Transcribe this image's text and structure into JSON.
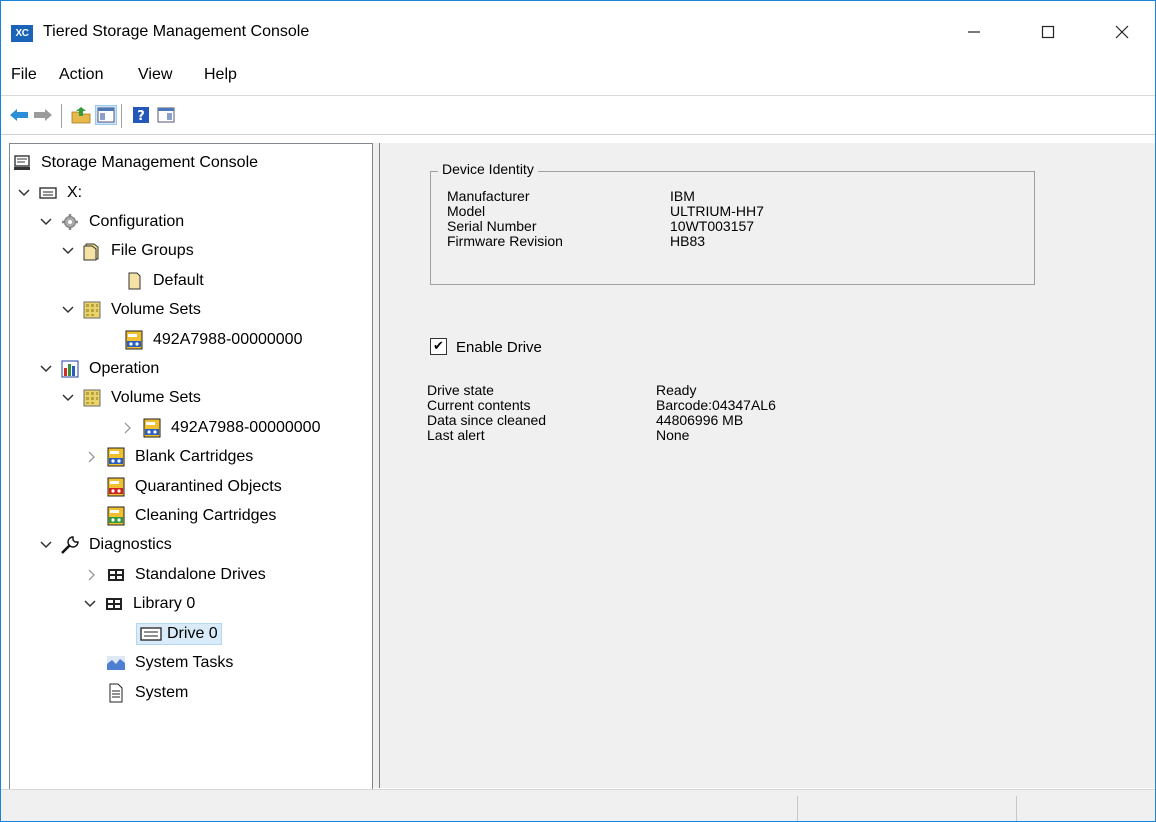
{
  "app": {
    "icon_text": "XC",
    "title": "Tiered Storage Management Console"
  },
  "window_controls": {
    "minimize": "—",
    "maximize": "☐",
    "close": "✕"
  },
  "menu": [
    "File",
    "Action",
    "View",
    "Help"
  ],
  "toolbar": {
    "buttons": [
      {
        "icon": "back-arrow-icon"
      },
      {
        "icon": "forward-arrow-icon"
      },
      {
        "icon": "up-folder-icon"
      },
      {
        "icon": "show-hide-tree-icon",
        "pressed": true
      },
      {
        "icon": "help-icon"
      },
      {
        "icon": "action-pane-icon"
      }
    ]
  },
  "tree": {
    "root": "Storage Management Console",
    "server": "X:",
    "configuration": "Configuration",
    "file_groups": "File Groups",
    "default": "Default",
    "volume_sets_config": "Volume Sets",
    "volume_config_item": "492A7988-00000000",
    "operation": "Operation",
    "volume_sets_op": "Volume Sets",
    "volume_op_item": "492A7988-00000000",
    "blank_cartridges": "Blank Cartridges",
    "quarantined_objects": "Quarantined Objects",
    "cleaning_cartridges": "Cleaning Cartridges",
    "diagnostics": "Diagnostics",
    "standalone_drives": "Standalone Drives",
    "library0": "Library 0",
    "drive0": "Drive 0",
    "system_tasks": "System Tasks",
    "system": "System"
  },
  "device_identity": {
    "title": "Device Identity",
    "rows": [
      {
        "label": "Manufacturer",
        "value": "IBM"
      },
      {
        "label": "Model",
        "value": "ULTRIUM-HH7"
      },
      {
        "label": "Serial Number",
        "value": "10WT003157"
      },
      {
        "label": "Firmware Revision",
        "value": "HB83"
      }
    ]
  },
  "enable_drive": {
    "label": "Enable Drive",
    "checked": true,
    "check_glyph": "✔"
  },
  "drive_status": {
    "rows": [
      {
        "label": "Drive state",
        "value": "Ready"
      },
      {
        "label": "Current contents",
        "value": "Barcode:04347AL6"
      },
      {
        "label": "Data since cleaned",
        "value": "44806996 MB"
      },
      {
        "label": "Last alert",
        "value": "None"
      }
    ]
  }
}
